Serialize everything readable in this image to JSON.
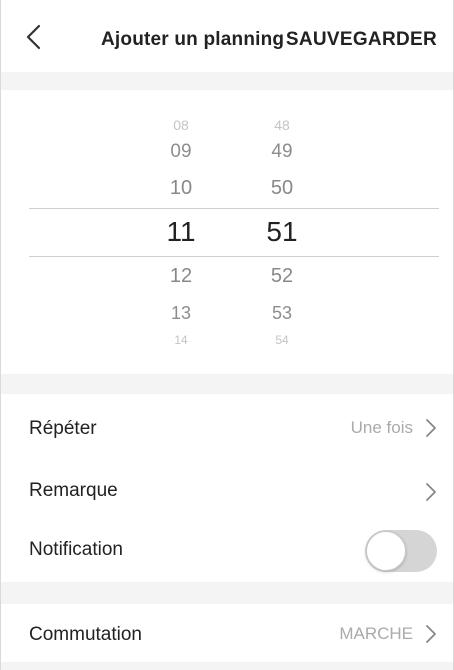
{
  "header": {
    "title": "Ajouter un planning",
    "save_label": "SAUVEGARDER",
    "back_icon": "chevron-left-icon"
  },
  "picker": {
    "hours": [
      "08",
      "09",
      "10",
      "11",
      "12",
      "13",
      "14"
    ],
    "minutes": [
      "48",
      "49",
      "50",
      "51",
      "52",
      "53",
      "54"
    ],
    "selected_hour": "11",
    "selected_minute": "51"
  },
  "settings": {
    "repeat": {
      "label": "Répéter",
      "value": "Une fois"
    },
    "note": {
      "label": "Remarque"
    },
    "notification": {
      "label": "Notification",
      "enabled": false
    },
    "switching": {
      "label": "Commutation",
      "value": "MARCHE"
    }
  },
  "colors": {
    "toggle_off": "#d5d5d5",
    "separator_bg": "#f4f4f4",
    "value_text": "#aaaaaa"
  }
}
